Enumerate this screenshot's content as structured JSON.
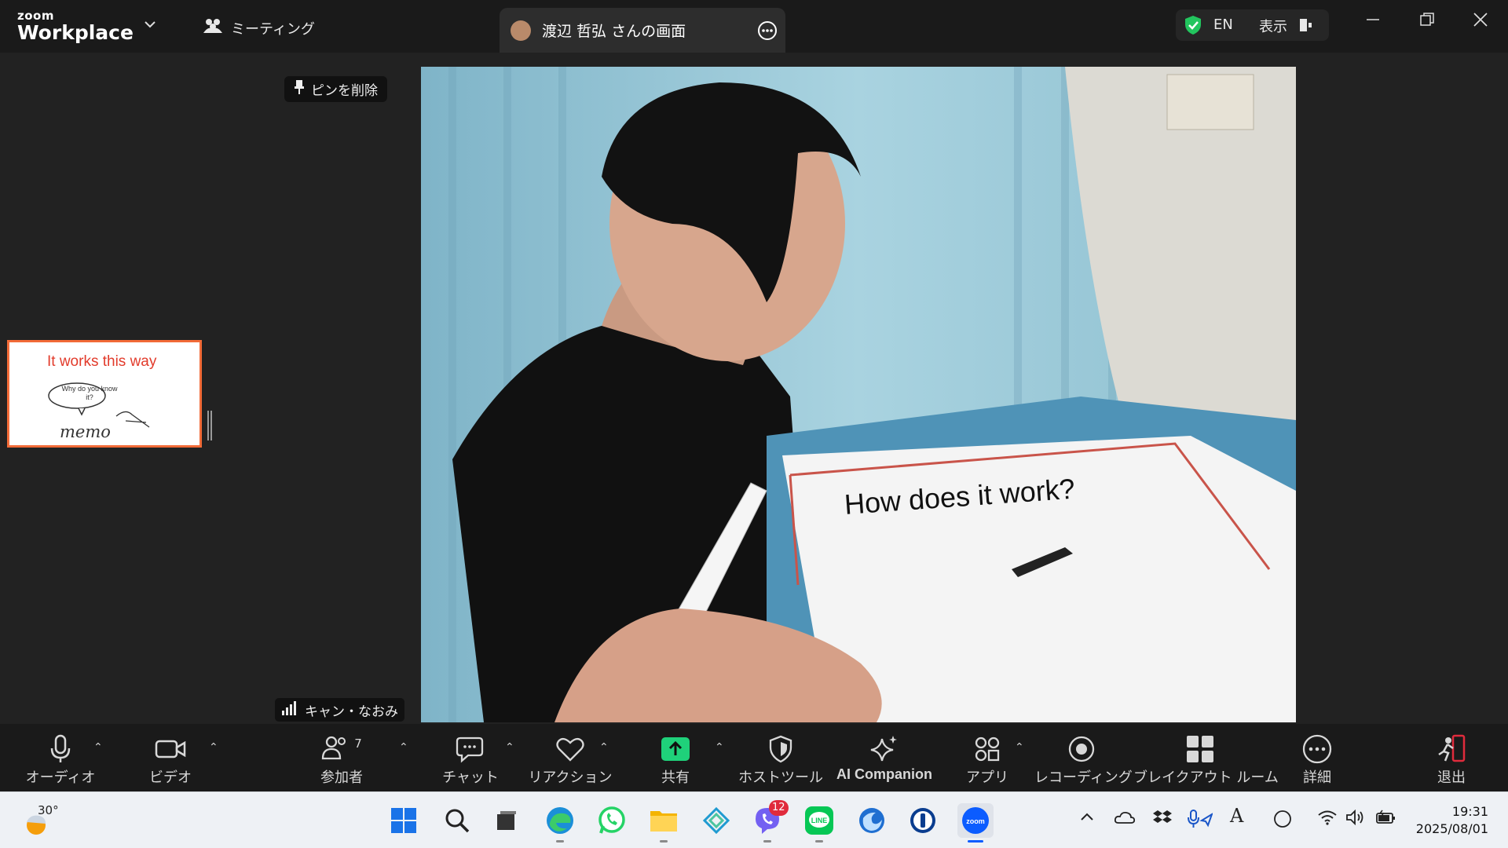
{
  "app": {
    "logo_top": "zoom",
    "logo_bottom": "Workplace",
    "meeting_tab": "ミーティング",
    "share_tab_title": "渡辺 哲弘 さんの画面",
    "lang": "EN",
    "display_label": "表示"
  },
  "stage": {
    "unpin_label": "ピンを削除",
    "participant_name": "キャン・なおみ",
    "thumbnail_title": "It works this way",
    "thumbnail_bubble": "Why do you know it?",
    "thumbnail_word": "memo",
    "video_card_text": "How does it work?"
  },
  "toolbar": {
    "audio": "オーディオ",
    "video": "ビデオ",
    "participants": "参加者",
    "participants_count": "7",
    "chat": "チャット",
    "reactions": "リアクション",
    "share": "共有",
    "host_tools": "ホストツール",
    "ai_companion": "AI Companion",
    "apps": "アプリ",
    "recording": "レコーディング",
    "breakout": "ブレイクアウト ルーム",
    "more": "詳細",
    "leave": "退出"
  },
  "taskbar": {
    "weather_temp": "30°",
    "viber_badge": "12",
    "time": "19:31",
    "date": "2025/08/01"
  },
  "colors": {
    "share_green": "#1fd17a",
    "shield_green": "#22c55e",
    "leave_red": "#e02b3c",
    "thumb_border": "#f26b38"
  }
}
